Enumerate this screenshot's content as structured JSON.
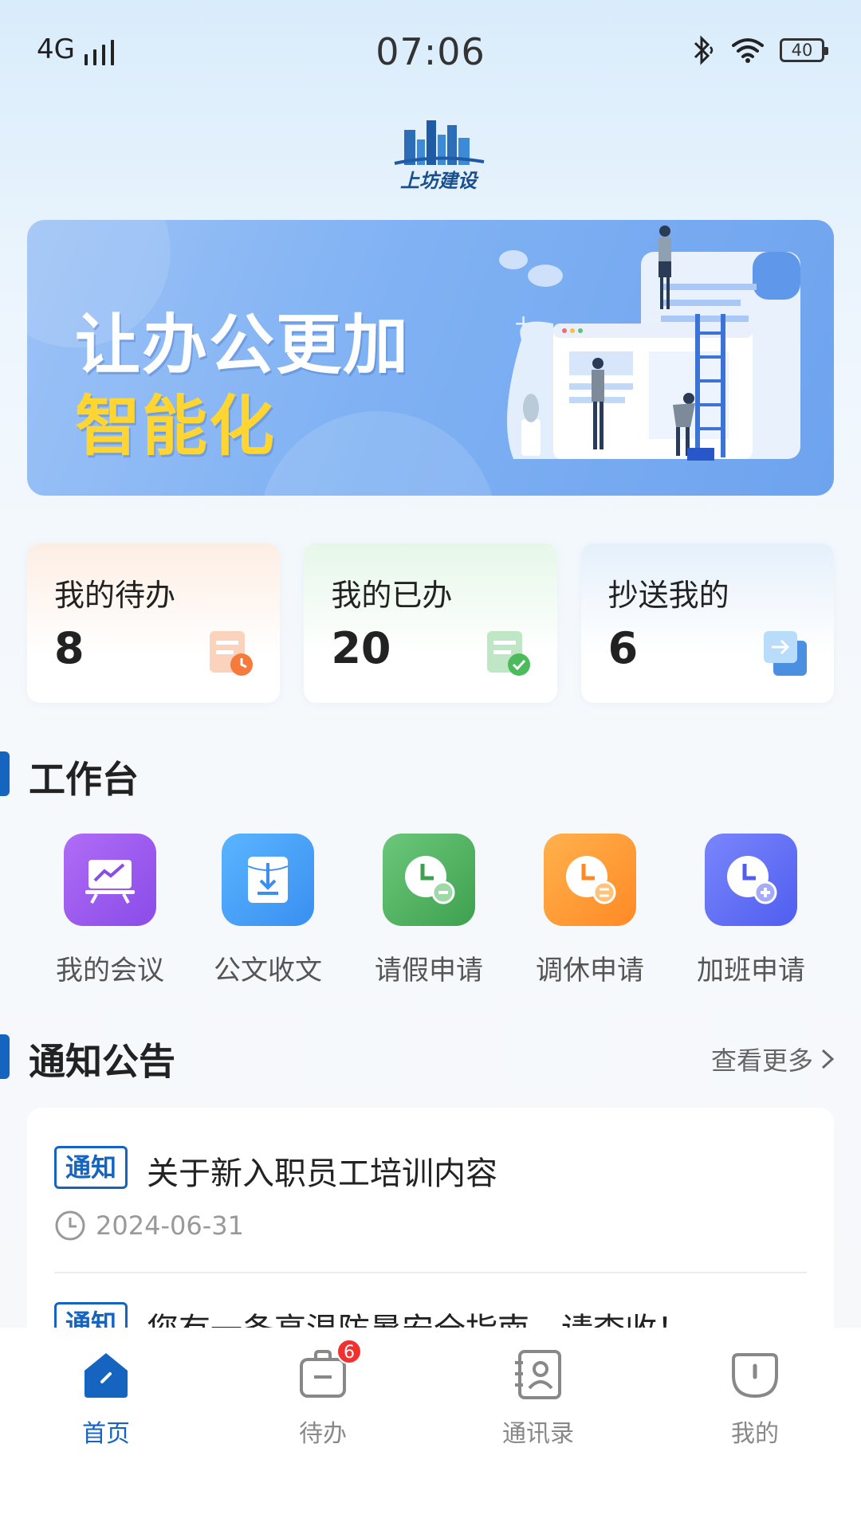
{
  "status_bar": {
    "network": "4G",
    "time": "07:06",
    "battery": "40"
  },
  "banner": {
    "line1": "让办公更加",
    "line2": "智能化"
  },
  "stats": [
    {
      "label": "我的待办",
      "value": "8"
    },
    {
      "label": "我的已办",
      "value": "20"
    },
    {
      "label": "抄送我的",
      "value": "6"
    }
  ],
  "workbench": {
    "title": "工作台",
    "items": [
      {
        "label": "我的会议",
        "icon": "meeting-icon",
        "color": "#9b5cf0"
      },
      {
        "label": "公文收文",
        "icon": "document-receive-icon",
        "color": "#4aa4f6"
      },
      {
        "label": "请假申请",
        "icon": "leave-clock-icon",
        "color": "#52b35e"
      },
      {
        "label": "调休申请",
        "icon": "shift-clock-icon",
        "color": "#ff9a35"
      },
      {
        "label": "加班申请",
        "icon": "overtime-clock-icon",
        "color": "#6270f5"
      }
    ]
  },
  "notices": {
    "title": "通知公告",
    "more_label": "查看更多",
    "items": [
      {
        "tag": "通知",
        "title": "关于新入职员工培训内容",
        "date": "2024-06-31"
      },
      {
        "tag": "通知",
        "title": "您有一条高温防暑安全指南，请查收！"
      }
    ]
  },
  "bottom_nav": {
    "items": [
      {
        "label": "首页",
        "active": true
      },
      {
        "label": "待办",
        "badge": "6"
      },
      {
        "label": "通讯录"
      },
      {
        "label": "我的"
      }
    ]
  },
  "colors": {
    "primary": "#1565c0",
    "banner_highlight": "#ffd531",
    "badge": "#f0312f"
  }
}
